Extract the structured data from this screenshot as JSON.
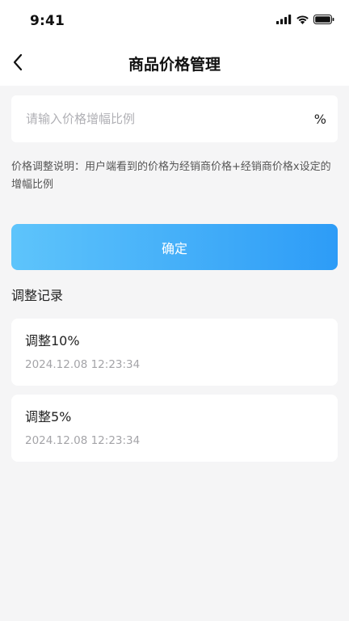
{
  "status_bar": {
    "time": "9:41",
    "icons": [
      "signal-icon",
      "wifi-icon",
      "battery-icon"
    ]
  },
  "nav": {
    "title": "商品价格管理",
    "back_icon": "chevron-left-icon"
  },
  "form": {
    "placeholder": "请输入价格增幅比例",
    "value": "",
    "unit": "%"
  },
  "note": "价格调整说明：用户端看到的价格为经销商价格+经销商价格x设定的增幅比例",
  "confirm_label": "确定",
  "records_title": "调整记录",
  "records": [
    {
      "title": "调整10%",
      "time": "2024.12.08 12:23:34"
    },
    {
      "title": "调整5%",
      "time": "2024.12.08 12:23:34"
    }
  ],
  "colors": {
    "button_gradient_start": "#5ec4fb",
    "button_gradient_end": "#2d9cf7",
    "background": "#f5f5f6"
  }
}
